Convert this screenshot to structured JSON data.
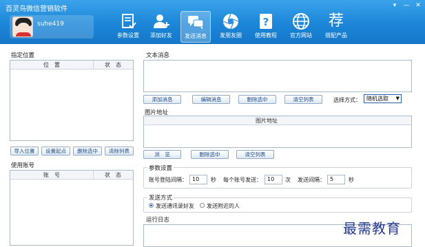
{
  "window": {
    "title": "百灵鸟微信营销软件",
    "controls": [
      "▾",
      "—",
      "✕"
    ]
  },
  "user": {
    "name": "suhe419"
  },
  "nav": [
    {
      "label": "参数设置",
      "icon": "document-check-icon"
    },
    {
      "label": "添加好友",
      "icon": "add-user-icon"
    },
    {
      "label": "发送消息",
      "icon": "chat-bubbles-icon",
      "active": true
    },
    {
      "label": "发朋友圈",
      "icon": "shutter-icon"
    },
    {
      "label": "使用教程",
      "icon": "help-book-icon"
    },
    {
      "label": "官方网站",
      "icon": "globe-icon"
    },
    {
      "label": "搭配产品",
      "icon": "recommend-icon",
      "glyph": "荐"
    }
  ],
  "left": {
    "position_title": "指定位置",
    "position_columns": [
      "位　置",
      "状　态"
    ],
    "position_buttons": [
      "导入位置",
      "设置起点",
      "删除选中",
      "清除列表"
    ],
    "account_title": "使用账号",
    "account_columns": [
      "账　号",
      "状　态"
    ]
  },
  "right": {
    "text_message_label": "文本消息",
    "message_buttons": [
      "添加消息",
      "编辑消息",
      "删除选中",
      "清空列表"
    ],
    "select_mode_label": "选择方式：",
    "select_mode_value": "随机选取",
    "image_label": "图片地址",
    "image_column": "图片地址",
    "image_buttons": [
      "浏　览",
      "删除选中",
      "清空列表"
    ],
    "params_title": "参数设置",
    "login_interval_label": "账号登陆间隔：",
    "login_interval_value": "10",
    "login_interval_unit": "秒",
    "per_account_label": "每个账号发送：",
    "per_account_value": "10",
    "per_account_unit": "次",
    "send_interval_label": "发送间隔：",
    "send_interval_value": "5",
    "send_interval_unit": "秒",
    "send_mode_title": "发送方式",
    "send_mode_options": [
      "发送通讯录好友",
      "发送附近的人"
    ],
    "send_mode_selected": 0,
    "log_title": "运行日志"
  },
  "watermark": "最需教育",
  "colors": {
    "header": "#1c86d8",
    "accent": "#1e6fc7",
    "button_text": "#1f4d86"
  }
}
